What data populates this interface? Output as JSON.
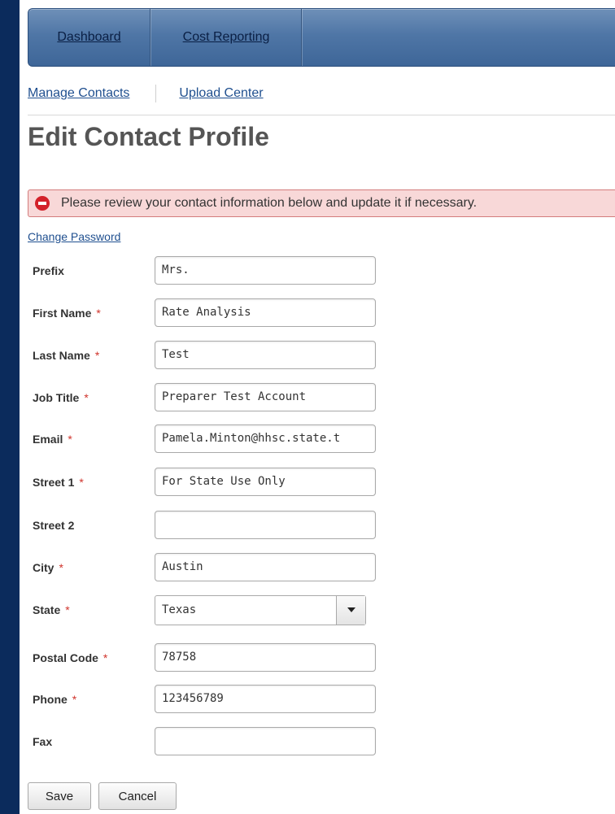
{
  "nav": {
    "tabs": [
      "Dashboard",
      "Cost Reporting"
    ]
  },
  "subnav": {
    "links": [
      "Manage Contacts",
      "Upload Center"
    ]
  },
  "page_title": "Edit Contact Profile",
  "alert": {
    "message": "Please review your contact information below and update it if necessary.",
    "color": "#d3212a"
  },
  "change_password": "Change Password",
  "form": {
    "prefix": {
      "label": "Prefix",
      "value": "Mrs."
    },
    "first_name": {
      "label": "First Name",
      "value": "Rate Analysis"
    },
    "last_name": {
      "label": "Last Name",
      "value": "Test"
    },
    "job_title": {
      "label": "Job Title",
      "value": "Preparer Test Account"
    },
    "email": {
      "label": "Email",
      "value": "Pamela.Minton@hhsc.state.t"
    },
    "street1": {
      "label": "Street 1",
      "value": "For State Use Only"
    },
    "street2": {
      "label": "Street 2",
      "value": ""
    },
    "city": {
      "label": "City",
      "value": "Austin"
    },
    "state": {
      "label": "State",
      "value": "Texas"
    },
    "postal_code": {
      "label": "Postal Code",
      "value": "78758"
    },
    "phone": {
      "label": "Phone",
      "value": "123456789"
    },
    "fax": {
      "label": "Fax",
      "value": ""
    },
    "required_marker": "*"
  },
  "buttons": {
    "save": "Save",
    "cancel": "Cancel"
  }
}
